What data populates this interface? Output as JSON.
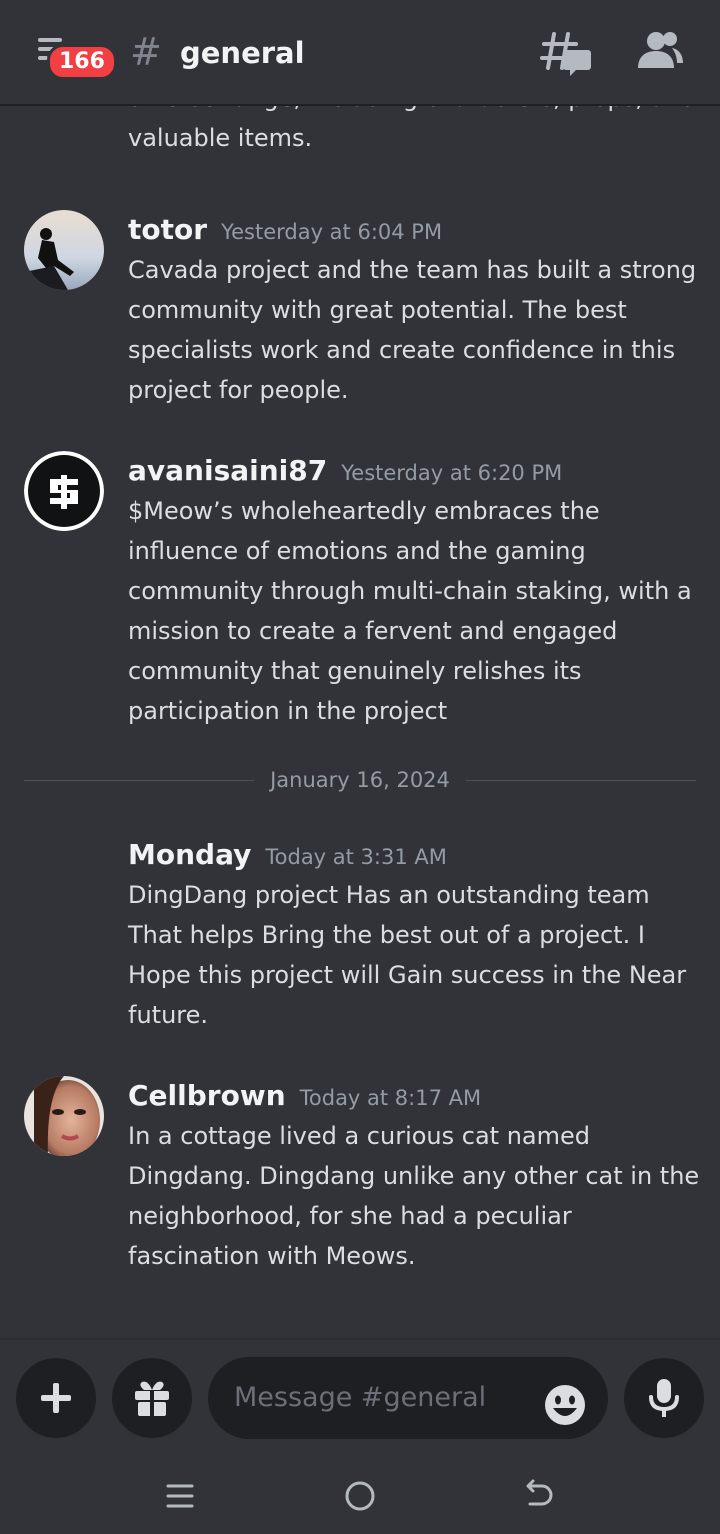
{
  "header": {
    "badge_count": "166",
    "hash_symbol": "#",
    "channel_name": "general"
  },
  "messages": {
    "cut_top_text": "diverse range, including characters, props, and valuable items.",
    "items": [
      {
        "author": "totor",
        "time": "Yesterday at 6:04 PM",
        "text": "Cavada project and the team has built a strong community with great potential. The best specialists work and create confidence in this project for people."
      },
      {
        "author": "avanisaini87",
        "time": "Yesterday at 6:20 PM",
        "text": "$Meow’s wholeheartedly embraces the influence of emotions and the gaming community through multi-chain staking, with a mission to create a fervent and engaged community that genuinely relishes its participation in the project"
      },
      {
        "author": "Monday",
        "time": "Today at 3:31 AM",
        "text": "DingDang project Has an outstanding team That helps Bring the best out of a project. I Hope this project will Gain success in the Near future."
      },
      {
        "author": "Cellbrown",
        "time": "Today at 8:17 AM",
        "text": "In a cottage lived a curious cat named Dingdang. Dingdang unlike any other cat in the neighborhood, for she had a peculiar fascination with Meows."
      }
    ],
    "date_divider": "January 16, 2024"
  },
  "composer": {
    "placeholder": "Message #general"
  },
  "icons": {
    "menu": "hamburger-menu-icon",
    "threads": "threads-icon",
    "members": "members-icon",
    "add": "plus-icon",
    "gift": "gift-icon",
    "emoji": "emoji-icon",
    "mic": "microphone-icon",
    "recents": "recent-apps-icon",
    "home": "home-icon",
    "back": "back-icon"
  },
  "colors": {
    "background": "#313338",
    "badge": "#f23f43",
    "input_bg": "#1e1f22",
    "muted_text": "#949ba4"
  }
}
